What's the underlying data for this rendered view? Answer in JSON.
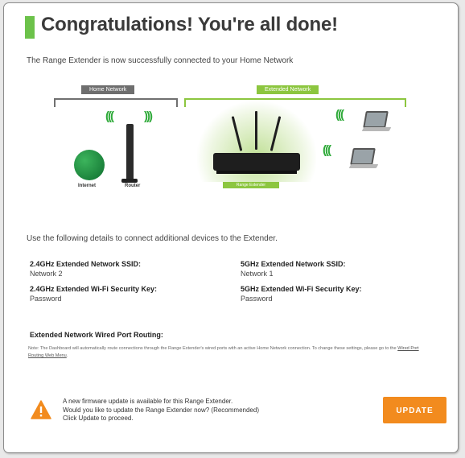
{
  "header": {
    "title": "Congratulations! You're all done!",
    "intro": "The Range Extender is now successfully connected to your Home Network"
  },
  "diagram": {
    "home_network_label": "Home Network",
    "extended_network_label": "Extended Network",
    "internet_label": "Internet",
    "router_label": "Router",
    "range_extender_label": "Range Extender"
  },
  "details": {
    "intro": "Use the following details to connect additional devices to the Extender.",
    "ssid_24_label": "2.4GHz Extended Network SSID:",
    "ssid_24_value": "Network 2",
    "key_24_label": "2.4GHz Extended Wi-Fi Security Key:",
    "key_24_value": "Password",
    "ssid_5_label": "5GHz Extended Network SSID:",
    "ssid_5_value": "Network 1",
    "key_5_label": "5GHz Extended Wi-Fi Security Key:",
    "key_5_value": "Password"
  },
  "wired": {
    "label": "Extended Network Wired Port Routing:",
    "note_part1": "Note: The Dashboard will automatically route connections through the Range Extender's wired ports with an active Home Network connection. To change these settings, please go to the ",
    "note_link": "Wired Port Routing Web Menu",
    "note_part2": "."
  },
  "firmware": {
    "line1": "A new firmware update is available for this Range Extender.",
    "line2": "Would you like to update the Range Extender now? (Recommended)",
    "line3": "Click Update to proceed.",
    "update_button": "UPDATE"
  },
  "colors": {
    "accent_green": "#6cc24a",
    "update_orange": "#f28b1e",
    "warning_orange": "#f28b1e"
  },
  "icons": [
    "warning-icon",
    "router-icon",
    "internet-globe-icon",
    "range-extender-icon",
    "laptop-icon",
    "wifi-signal-icon"
  ]
}
